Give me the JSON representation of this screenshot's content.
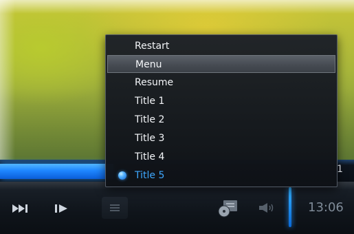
{
  "menu": {
    "items": [
      {
        "label": "Restart",
        "state": "normal"
      },
      {
        "label": "Menu",
        "state": "highlighted"
      },
      {
        "label": "Resume",
        "state": "normal"
      },
      {
        "label": "Title 1",
        "state": "normal"
      },
      {
        "label": "Title 2",
        "state": "normal"
      },
      {
        "label": "Title 3",
        "state": "normal"
      },
      {
        "label": "Title 4",
        "state": "normal"
      },
      {
        "label": "Title 5",
        "state": "selected"
      }
    ]
  },
  "player": {
    "seek_time_fragment": "1",
    "clock": "13:06",
    "progress_fraction": 0.32,
    "volume_level": 0.85
  },
  "icons": {
    "next": "next-icon",
    "step_forward": "step-forward-icon",
    "playlist": "playlist-icon",
    "dvd_menu": "dvd-menu-icon",
    "volume": "volume-icon",
    "selected_marker": "radio-dot-icon"
  },
  "colors": {
    "accent": "#1e86ff",
    "selected_text": "#3ea8ff",
    "menu_text": "#f4f6f9",
    "clock_text": "#7f8b98"
  }
}
